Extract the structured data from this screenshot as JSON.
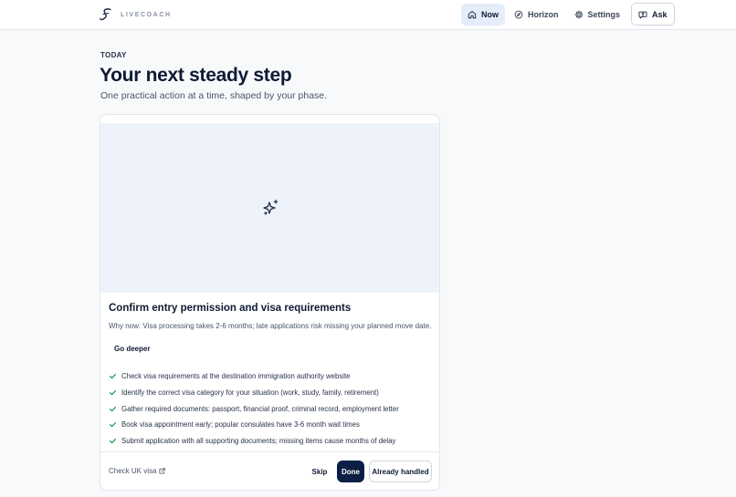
{
  "brand": {
    "name": "LIVECOACH",
    "logo_icon": "script-s-logo"
  },
  "nav": {
    "items": [
      {
        "label": "Now",
        "icon": "home-icon",
        "active": true
      },
      {
        "label": "Horizon",
        "icon": "compass-icon",
        "active": false
      },
      {
        "label": "Settings",
        "icon": "gear-icon",
        "active": false
      },
      {
        "label": "Ask",
        "icon": "help-circle-icon",
        "active": false
      }
    ]
  },
  "page": {
    "eyebrow": "TODAY",
    "title": "Your next steady step",
    "subtitle": "One practical action at a time, shaped by your phase."
  },
  "card": {
    "hero_icon": "sparkles-icon",
    "title": "Confirm entry permission and visa requirements",
    "why": "Why now: Visa processing takes 2-6 months; late applications risk missing your planned move date.",
    "go_deeper_label": "Go deeper",
    "steps": [
      "Check visa requirements at the destination immigration authority website",
      "Identify the correct visa category for your situation (work, study, family, retirement)",
      "Gather required documents: passport, financial proof, criminal record, employment letter",
      "Book visa appointment early; popular consulates have 3-6 month wait times",
      "Submit application with all supporting documents; missing items cause months of delay"
    ],
    "external_link": "Check UK visa",
    "actions": {
      "skip": "Skip",
      "done": "Done",
      "handled": "Already handled"
    }
  },
  "colors": {
    "accent": "#0b1f44",
    "active_nav_bg": "#e4edf8",
    "hero_bg": "#eef2fb",
    "check": "#1f8a5a"
  }
}
